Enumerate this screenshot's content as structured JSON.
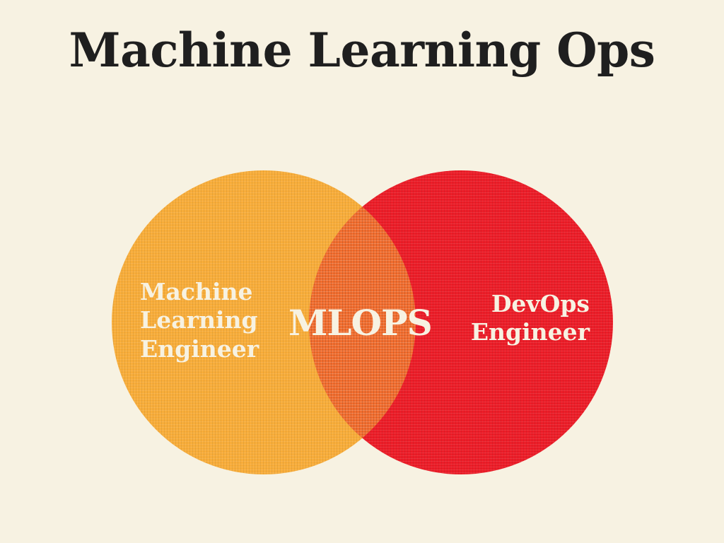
{
  "title": "Machine Learning Ops",
  "left_set": {
    "lines": [
      "Machine",
      "Learning",
      "Engineer"
    ],
    "color": "#f8ad3a"
  },
  "right_set": {
    "lines": [
      "DevOps",
      "Engineer"
    ],
    "color": "#ec1d28"
  },
  "intersection": {
    "label": "MLOPS",
    "color": "#f26d2e"
  },
  "colors": {
    "background": "#f7f2e2",
    "title_text": "#1f1f1f",
    "label_text": "#f7f2e2"
  }
}
